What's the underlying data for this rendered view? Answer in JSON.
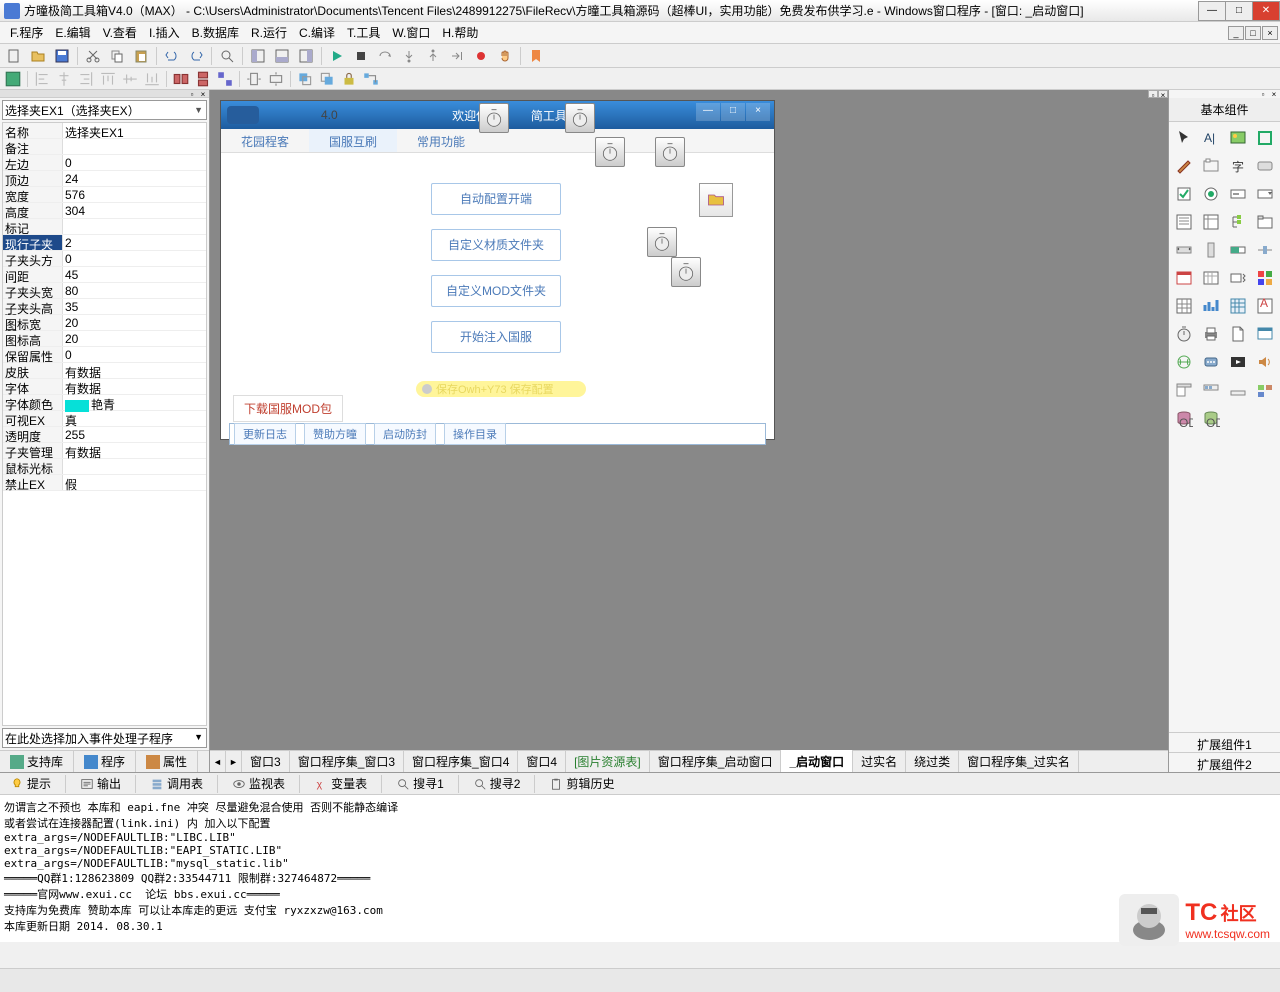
{
  "window": {
    "title": "方曈极简工具箱V4.0（MAX）  - C:\\Users\\Administrator\\Documents\\Tencent Files\\2489912275\\FileRecv\\方曈工具箱源码（超棒UI，实用功能）免费发布供学习.e - Windows窗口程序 - [窗口: _启动窗口]"
  },
  "menu": [
    "F.程序",
    "E.编辑",
    "V.查看",
    "I.插入",
    "B.数据库",
    "R.运行",
    "C.编译",
    "T.工具",
    "W.窗口",
    "H.帮助"
  ],
  "left": {
    "combo": "选择夹EX1（选择夹EX）",
    "event_combo": "在此处选择加入事件处理子程序",
    "tabs": [
      "支持库",
      "程序",
      "属性"
    ],
    "props": [
      {
        "name": "名称",
        "val": "选择夹EX1"
      },
      {
        "name": "备注",
        "val": ""
      },
      {
        "name": "左边",
        "val": "0"
      },
      {
        "name": "顶边",
        "val": "24"
      },
      {
        "name": "宽度",
        "val": "576"
      },
      {
        "name": "高度",
        "val": "304"
      },
      {
        "name": "标记",
        "val": ""
      },
      {
        "name": "现行子夹",
        "val": "2",
        "sel": true
      },
      {
        "name": "子夹头方向",
        "val": "0"
      },
      {
        "name": "间距",
        "val": "45"
      },
      {
        "name": "子夹头宽度",
        "val": "80"
      },
      {
        "name": "子夹头高度",
        "val": "35"
      },
      {
        "name": "图标宽",
        "val": "20"
      },
      {
        "name": "图标高",
        "val": "20"
      },
      {
        "name": "保留属性",
        "val": "0"
      },
      {
        "name": "皮肤",
        "val": "有数据"
      },
      {
        "name": "字体",
        "val": "有数据"
      },
      {
        "name": "字体颜色",
        "val": "艳青",
        "color": true
      },
      {
        "name": "可视EX",
        "val": "真"
      },
      {
        "name": "透明度",
        "val": "255"
      },
      {
        "name": "子夹管理",
        "val": "有数据"
      },
      {
        "name": "鼠标光标",
        "val": ""
      },
      {
        "name": "禁止EX",
        "val": "假"
      }
    ]
  },
  "form": {
    "chrome_text_left": "欢迎使用",
    "chrome_text_right": "简工具箱",
    "version": "4.0",
    "tabs": [
      "花园程客",
      "国服互刷",
      "常用功能"
    ],
    "buttons": [
      "自动配置开端",
      "自定义材质文件夹",
      "自定义MOD文件夹",
      "开始注入国服"
    ],
    "hint": "保存Owh+Y73 保存配置",
    "link": "下载国服MOD包",
    "minibtns": [
      "更新日志",
      "赞助方曈",
      "启动防封",
      "操作目录"
    ]
  },
  "doc_tabs": [
    "窗口3",
    "窗口程序集_窗口3",
    "窗口程序集_窗口4",
    "窗口4",
    "[图片资源表]",
    "窗口程序集_启动窗口",
    "_启动窗口",
    "过实名",
    "绕过类",
    "窗口程序集_过实名"
  ],
  "right": {
    "title": "基本组件",
    "groups": [
      "扩展组件1",
      "扩展组件2"
    ]
  },
  "bottom": {
    "tabs": [
      "提示",
      "输出",
      "调用表",
      "监视表",
      "变量表",
      "搜寻1",
      "搜寻2",
      "剪辑历史"
    ],
    "console": "勿谓言之不预也 本库和 eapi.fne 冲突 尽量避免混合使用 否则不能静态编译\n或者尝试在连接器配置(link.ini) 内 加入以下配置\nextra_args=/NODEFAULTLIB:\"LIBC.LIB\"\nextra_args=/NODEFAULTLIB:\"EAPI_STATIC.LIB\"\nextra_args=/NODEFAULTLIB:\"mysql_static.lib\"\n═════QQ群1:128623809 QQ群2:33544711 限制群:327464872═════\n═════官网www.exui.cc  论坛 bbs.exui.cc═════\n支持库为免费库 赞助本库 可以让本库走的更远 支付宝 ryxzxzw@163.com\n本库更新日期 2014. 08.30.1"
  },
  "watermark": {
    "brand": "TC",
    "suffix": "社区",
    "url": "www.tcsqw.com"
  }
}
